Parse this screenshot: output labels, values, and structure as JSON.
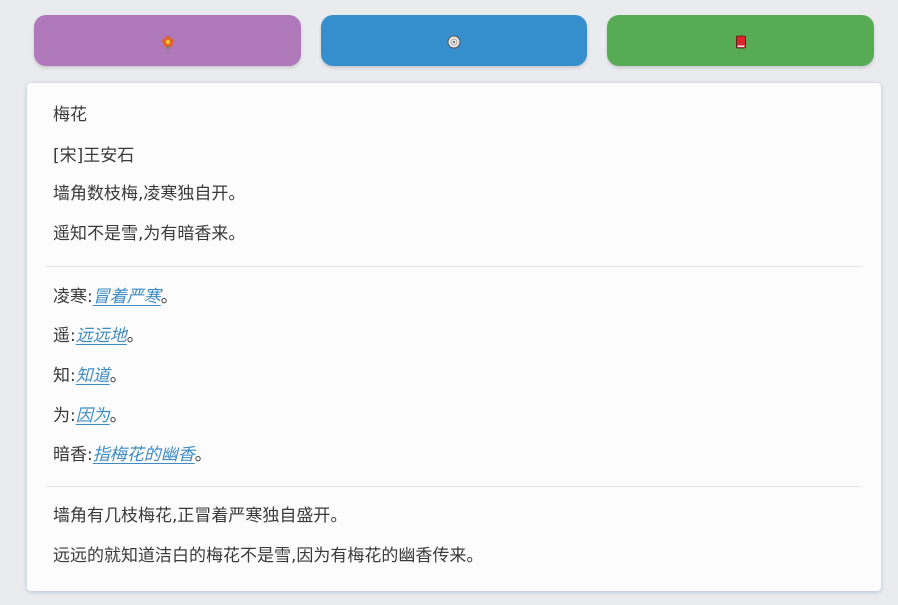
{
  "toolbar": {
    "buttons": [
      {
        "name": "flower",
        "icon": "flower-icon",
        "color": "#af79bb"
      },
      {
        "name": "audio",
        "icon": "disc-icon",
        "color": "#368fcd"
      },
      {
        "name": "book",
        "icon": "red-book-icon",
        "color": "#58ab55"
      }
    ]
  },
  "poem": {
    "title": "梅花",
    "author": "[宋]王安石",
    "lines": [
      "墙角数枝梅,凌寒独自开。",
      "遥知不是雪,为有暗香来。"
    ]
  },
  "notes": [
    {
      "term": "凌寒",
      "sep": ":",
      "meaning": "冒着严寒",
      "end": "。"
    },
    {
      "term": "遥",
      "sep": ":",
      "meaning": "远远地",
      "end": "。"
    },
    {
      "term": "知",
      "sep": ":",
      "meaning": "知道",
      "end": "。"
    },
    {
      "term": "为",
      "sep": ":",
      "meaning": "因为",
      "end": "。"
    },
    {
      "term": "暗香",
      "sep": ":",
      "meaning": "指梅花的幽香",
      "end": "。"
    }
  ],
  "translation": {
    "lines": [
      "墙角有几枝梅花,正冒着严寒独自盛开。",
      "远远的就知道洁白的梅花不是雪,因为有梅花的幽香传来。"
    ]
  }
}
